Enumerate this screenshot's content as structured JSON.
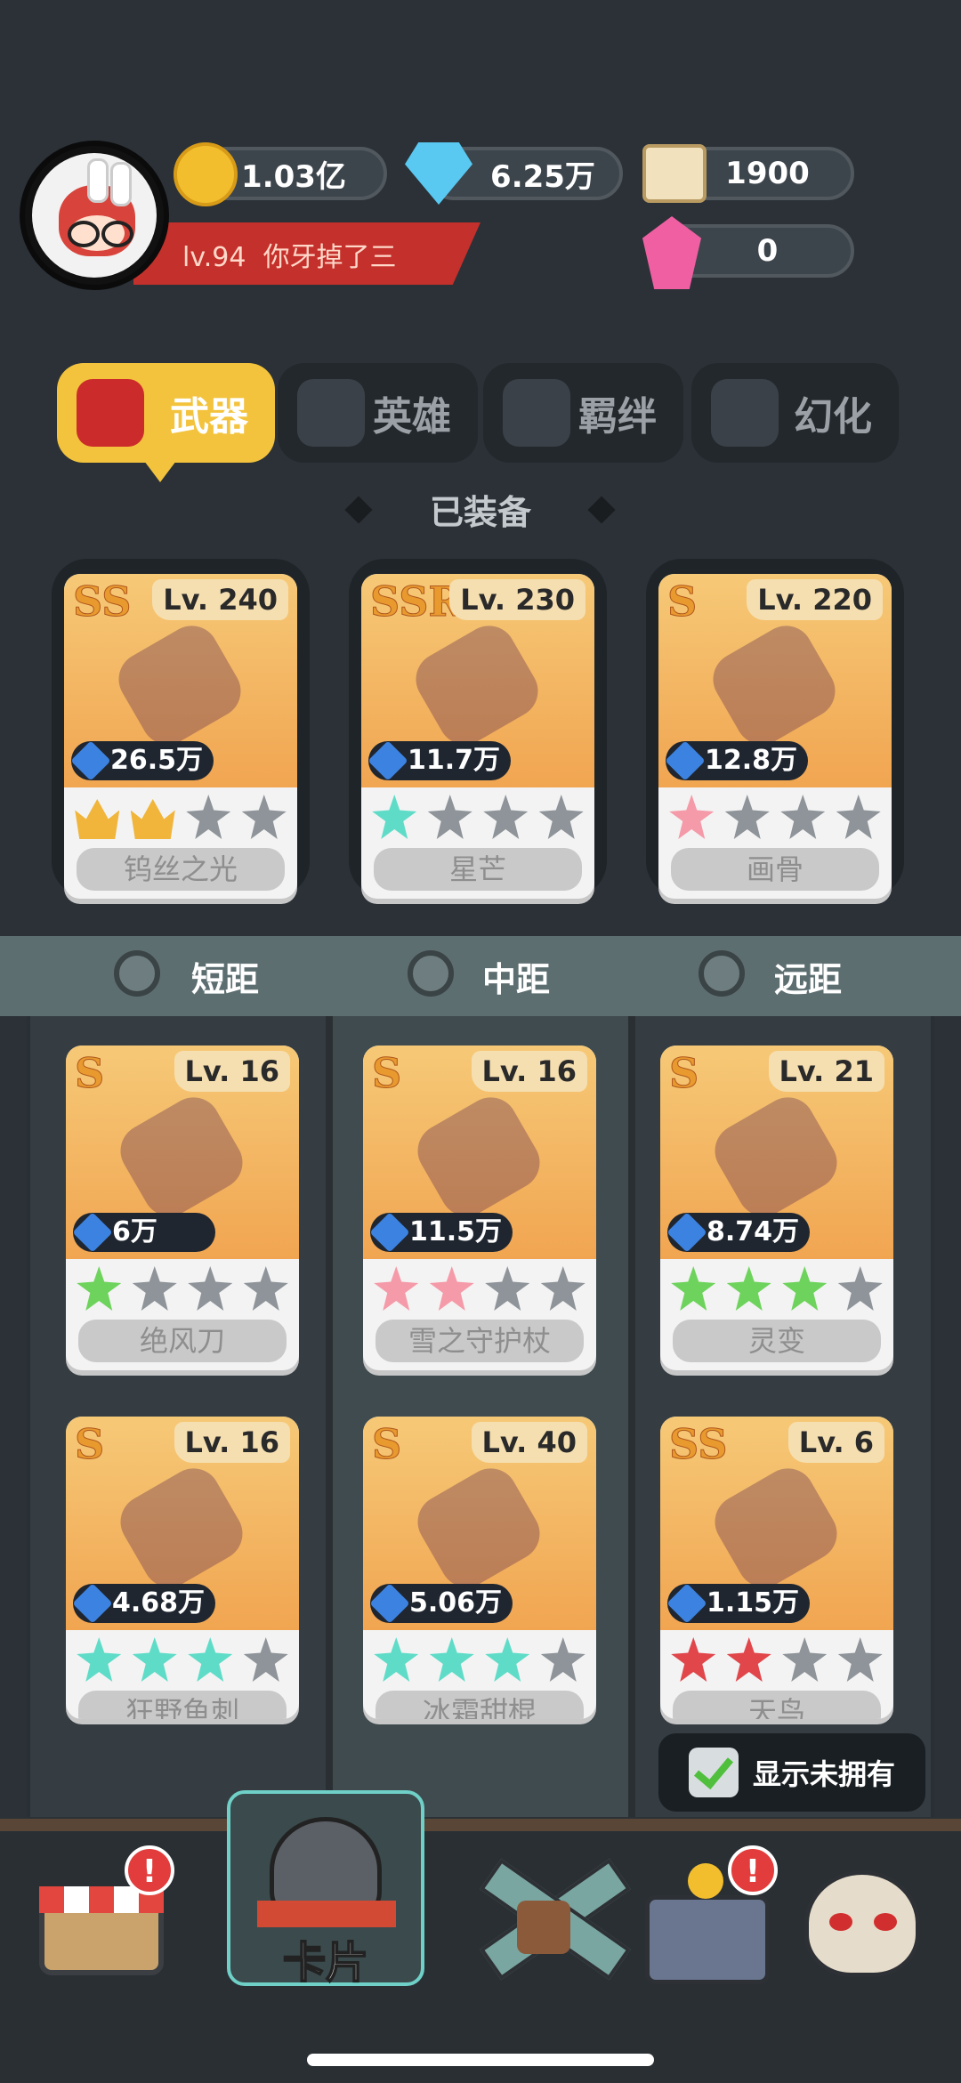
{
  "player": {
    "level": "lv.94",
    "name": "你牙掉了三"
  },
  "resources": {
    "gold": "1.03亿",
    "diamond": "6.25万",
    "scroll": "1900",
    "crystal": "0"
  },
  "tabs": [
    {
      "label": "武器",
      "active": true
    },
    {
      "label": "英雄",
      "active": false
    },
    {
      "label": "羁绊",
      "active": false
    },
    {
      "label": "幻化",
      "active": false
    }
  ],
  "equipped_title": "已装备",
  "equipped": [
    {
      "rank": "SS",
      "level": "Lv. 240",
      "power": "26.5万",
      "stars": [
        "crown",
        "crown",
        "grey",
        "grey"
      ],
      "name": "钨丝之光"
    },
    {
      "rank": "SSR",
      "level": "Lv. 230",
      "power": "11.7万",
      "stars": [
        "teal",
        "grey",
        "grey",
        "grey"
      ],
      "name": "星芒"
    },
    {
      "rank": "S",
      "level": "Lv. 220",
      "power": "12.8万",
      "stars": [
        "pink",
        "grey",
        "grey",
        "grey"
      ],
      "name": "画骨"
    }
  ],
  "ranges": [
    "短距",
    "中距",
    "远距"
  ],
  "weapons": [
    {
      "rank": "S",
      "level": "Lv. 16",
      "power": "6万",
      "stars": [
        "green",
        "grey",
        "grey",
        "grey"
      ],
      "name": "绝风刀"
    },
    {
      "rank": "S",
      "level": "Lv. 16",
      "power": "11.5万",
      "stars": [
        "pink",
        "pink",
        "grey",
        "grey"
      ],
      "name": "雪之守护杖"
    },
    {
      "rank": "S",
      "level": "Lv. 21",
      "power": "8.74万",
      "stars": [
        "green",
        "green",
        "green",
        "grey"
      ],
      "name": "灵变"
    },
    {
      "rank": "S",
      "level": "Lv. 16",
      "power": "4.68万",
      "stars": [
        "teal",
        "teal",
        "teal",
        "grey"
      ],
      "name": "狂野鱼刺"
    },
    {
      "rank": "S",
      "level": "Lv. 40",
      "power": "5.06万",
      "stars": [
        "teal",
        "teal",
        "teal",
        "grey"
      ],
      "name": "冰霜甜棍"
    },
    {
      "rank": "SS",
      "level": "Lv. 6",
      "power": "1.15万",
      "stars": [
        "red",
        "red",
        "grey",
        "grey"
      ],
      "name": "天鸟"
    }
  ],
  "show_unowned_label": "显示未拥有",
  "nav": {
    "shop_badge": "!",
    "cards_label": "卡片",
    "chest_badge": "!"
  },
  "colors": {
    "active_tab": "#f3c33d",
    "name_bar": "#c4302b",
    "badge": "#e23c3c"
  }
}
